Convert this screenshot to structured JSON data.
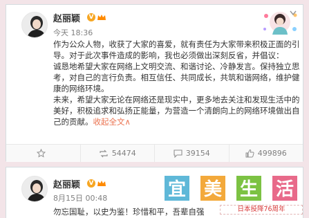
{
  "colors": {
    "expand_link": "#eb7350",
    "verified_badge": "#f6a623",
    "watermark_tile_1": "#5fb8d8",
    "watermark_tile_2": "#f3a93b",
    "watermark_tile_3": "#7cc243",
    "watermark_tile_4": "#e86a8a"
  },
  "post1": {
    "username": "赵丽颖",
    "verified_icon": "verified-badge-icon",
    "member_icon": "vip-crown-icon",
    "time": "今天 18:36",
    "paragraphs": [
      "作为公众人物，收获了大家的喜爱，就有责任为大家带来积极正面的引导。对于此次事件造成的影响，我也必须做出深刻反省，并倡议：",
      "诚恳地希望大家在网络上文明交流、和谐讨论、冷静发言。保持独立思考，对自己的言行负责。相互信任、共同成长，共筑和谐网络，维护健康的网络环境。",
      "未来，希望大家无论在网络还是现实中，更多地去关注和发现生活中的美好，积极追求和弘扬正能量，为营造一个清朗向上的网络环境做出自己的贡献。"
    ],
    "expand_label": "收起全文",
    "expand_suffix": "∧",
    "actions": {
      "favorite": {
        "icon": "star-icon",
        "label": ""
      },
      "repost": {
        "icon": "repost-icon",
        "label": "54474"
      },
      "comment": {
        "icon": "comment-icon",
        "label": "39154"
      },
      "like": {
        "icon": "thumbs-up-icon",
        "label": "499896"
      }
    }
  },
  "post2": {
    "username": "赵丽颖",
    "time": "8月15日 00:48",
    "text": "勿忘国耻，以史为鉴！珍惜和平，吾辈自强"
  },
  "watermark": {
    "characters": [
      "宜",
      "美",
      "生",
      "活"
    ],
    "subtitle": "日本投降76周年"
  }
}
